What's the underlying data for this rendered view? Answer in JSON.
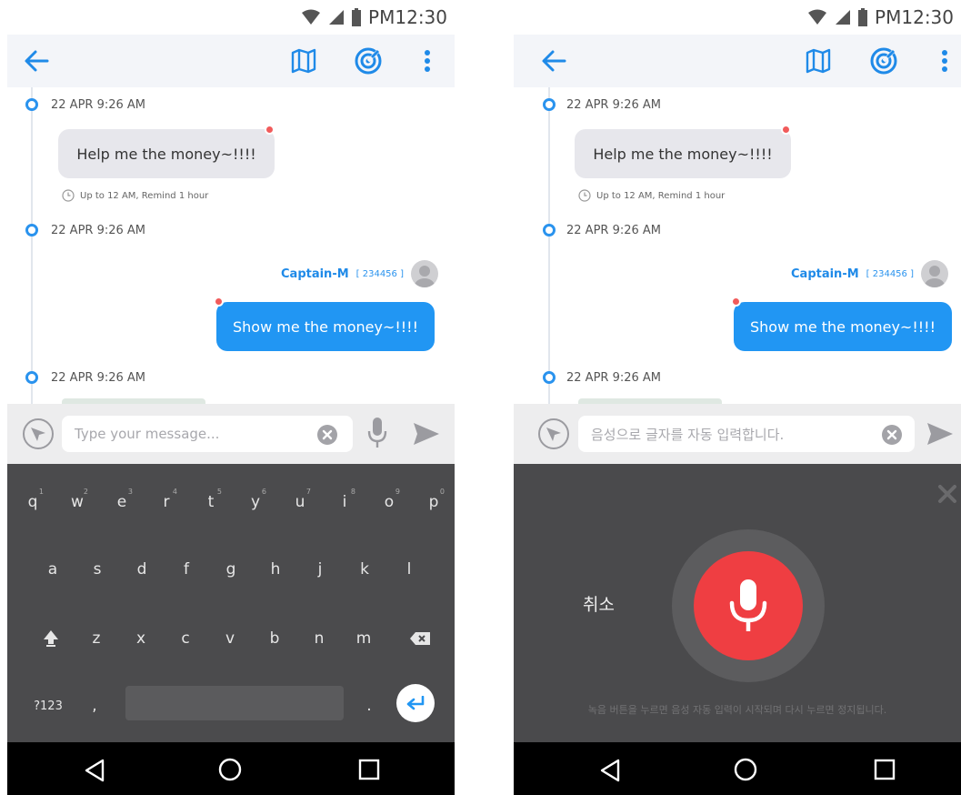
{
  "status": {
    "time": "PM12:30"
  },
  "colors": {
    "accent": "#2196f3",
    "timeline_dot": "#2a93ee",
    "unread": "#f15b5b",
    "mic": "#ef3e42",
    "keyboard_bg": "#4b4b4d"
  },
  "icons": [
    "back-arrow-icon",
    "map-icon",
    "radar-icon",
    "more-vert-icon",
    "location-icon",
    "clear-icon",
    "mic-icon",
    "send-icon",
    "back-nav-icon",
    "home-nav-icon",
    "recents-nav-icon"
  ],
  "chat": {
    "timestamps": [
      "22 APR 9:26 AM",
      "22 APR 9:26 AM",
      "22 APR 9:26 AM"
    ],
    "incoming_message": "Help me the money~!!!!",
    "reminder": "Up to 12 AM, Remind 1 hour",
    "sender_name": "Captain-M",
    "sender_id": "[ 234456 ]",
    "outgoing_message": "Show me the money~!!!!"
  },
  "input": {
    "placeholder_text": "Type your message...",
    "voice_placeholder": "음성으로 글자를 자동 입력합니다."
  },
  "keyboard": {
    "row1": [
      "q",
      "w",
      "e",
      "r",
      "t",
      "y",
      "u",
      "i",
      "o",
      "p"
    ],
    "row1_hints": [
      "1",
      "2",
      "3",
      "4",
      "5",
      "6",
      "7",
      "8",
      "9",
      "0"
    ],
    "row2": [
      "a",
      "s",
      "d",
      "f",
      "g",
      "h",
      "j",
      "k",
      "l"
    ],
    "row3": [
      "z",
      "x",
      "c",
      "v",
      "b",
      "n",
      "m"
    ],
    "symbols_label": "?123",
    "comma": ",",
    "period": "."
  },
  "voice": {
    "cancel_label": "취소",
    "hint": "녹음 버튼을 누르면 음성 자동 입력이 시작되며 다시 누르면 정지됩니다."
  }
}
